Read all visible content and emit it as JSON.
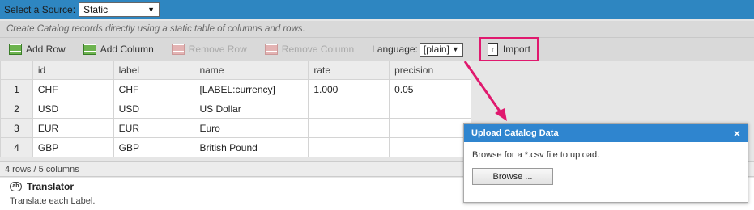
{
  "source_bar": {
    "label": "Select a Source:",
    "value": "Static"
  },
  "description": "Create Catalog records directly using a static table of columns and rows.",
  "toolbar": {
    "add_row": "Add Row",
    "add_column": "Add Column",
    "remove_row": "Remove Row",
    "remove_column": "Remove Column",
    "language_label": "Language:",
    "language_value": "[plain]",
    "import": "Import"
  },
  "table": {
    "columns": [
      "id",
      "label",
      "name",
      "rate",
      "precision"
    ],
    "rows": [
      {
        "num": "1",
        "id": "CHF",
        "label": "CHF",
        "name": "[LABEL:currency]",
        "rate": "1.000",
        "precision": "0.05"
      },
      {
        "num": "2",
        "id": "USD",
        "label": "USD",
        "name": "US Dollar",
        "rate": "",
        "precision": ""
      },
      {
        "num": "3",
        "id": "EUR",
        "label": "EUR",
        "name": "Euro",
        "rate": "",
        "precision": ""
      },
      {
        "num": "4",
        "id": "GBP",
        "label": "GBP",
        "name": "British Pound",
        "rate": "",
        "precision": ""
      }
    ]
  },
  "status": "4 rows / 5 columns",
  "translator": {
    "title": "Translator",
    "subtitle": "Translate each Label."
  },
  "dialog": {
    "title": "Upload Catalog Data",
    "close": "×",
    "body": "Browse for a *.csv file to upload.",
    "browse": "Browse ..."
  },
  "colors": {
    "accent": "#2f85cf",
    "highlight": "#e0196e"
  }
}
